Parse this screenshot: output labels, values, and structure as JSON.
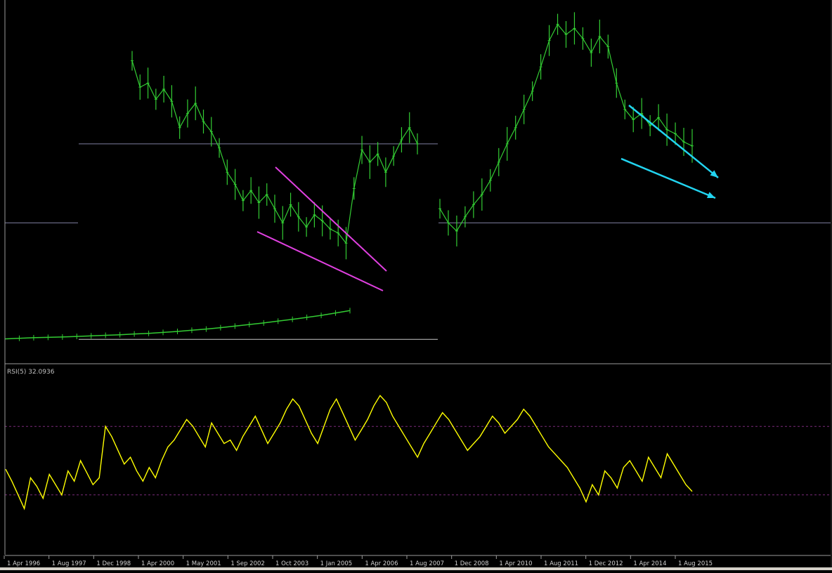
{
  "indicator": {
    "name": "RSI(5)",
    "value": "32.0936",
    "label": "RSI(5) 32.0936"
  },
  "colors": {
    "background": "#000000",
    "price": "#33cc33",
    "rsi": "#ffff00",
    "levels": "#7e7ea0",
    "rsi_levels": "#7a2a7a",
    "pattern_left": "#e040e0",
    "pattern_right": "#22d4f0",
    "axis": "#c8c8c8"
  },
  "chart_data": [
    {
      "type": "line",
      "series": [
        {
          "values": [
            0.5,
            0.49,
            0.48,
            0.46,
            0.44,
            0.43,
            0.42,
            0.41,
            0.4,
            0.4,
            0.39,
            0.4,
            0.41,
            0.43,
            0.45,
            0.48,
            0.52,
            0.56,
            0.6,
            0.65,
            0.7,
            0.76,
            0.82,
            0.9,
            0.98
          ]
        },
        {
          "values": [
            14.5,
            13.2,
            13.4,
            12.6,
            13.1,
            12.5,
            11.2,
            11.9,
            12.4,
            11.5,
            11.0,
            10.2,
            9.0,
            8.4,
            7.6,
            8.1,
            7.5,
            7.9,
            7.2,
            6.5,
            7.4,
            6.8,
            6.3,
            6.9,
            6.6,
            6.2,
            6.0,
            5.5,
            8.2,
            10.1,
            9.5,
            9.9,
            9.0,
            9.8,
            10.6,
            11.2,
            10.4
          ]
        },
        {
          "values": [
            7.2,
            6.5,
            6.1,
            6.8,
            7.4,
            7.9,
            8.6,
            9.5,
            10.4,
            11.2,
            12.1,
            13.0,
            14.2,
            15.5,
            16.3,
            15.8,
            16.1,
            15.6,
            14.9,
            15.7,
            15.2,
            13.4,
            12.1,
            11.6,
            11.9,
            11.3,
            11.7,
            11.1,
            10.9,
            10.5,
            10.3
          ]
        }
      ],
      "horizontal_levels": [
        10.4,
        12.0,
        6.5,
        0.96
      ]
    },
    {
      "type": "line",
      "title": "RSI(5) 32.0936",
      "series": [
        {
          "name": "RSI(5)",
          "values": [
            45,
            38,
            30,
            22,
            40,
            35,
            28,
            42,
            36,
            30,
            44,
            38,
            50,
            43,
            36,
            40,
            70,
            64,
            56,
            48,
            52,
            44,
            38,
            46,
            40,
            50,
            58,
            62,
            68,
            74,
            70,
            64,
            58,
            72,
            66,
            60,
            62,
            56,
            64,
            70,
            76,
            68,
            60,
            66,
            72,
            80,
            86,
            82,
            74,
            66,
            60,
            70,
            80,
            86,
            78,
            70,
            62,
            68,
            74,
            82,
            88,
            84,
            76,
            70,
            64,
            58,
            52,
            60,
            66,
            72,
            78,
            74,
            68,
            62,
            56,
            60,
            64,
            70,
            76,
            72,
            66,
            70,
            74,
            80,
            76,
            70,
            64,
            58,
            54,
            50,
            46,
            40,
            34,
            26,
            36,
            30,
            44,
            40,
            34,
            46,
            50,
            44,
            38,
            52,
            46,
            40,
            54,
            48,
            42,
            36,
            32
          ]
        }
      ],
      "ylim": [
        0,
        100
      ],
      "levels": [
        70,
        30
      ]
    }
  ],
  "x_axis": {
    "labels": [
      "1 Apr 1996",
      "1 Aug 1997",
      "1 Dec 1998",
      "1 Apr 2000",
      "1 May 2001",
      "1 Sep 2002",
      "1 Oct 2003",
      "1 Jan 2005",
      "1 Apr 2006",
      "1 Aug 2007",
      "1 Dec 2008",
      "1 Apr 2010",
      "1 Aug 2011",
      "1 Dec 2012",
      "1 Apr 2014",
      "1 Aug 2015"
    ]
  }
}
